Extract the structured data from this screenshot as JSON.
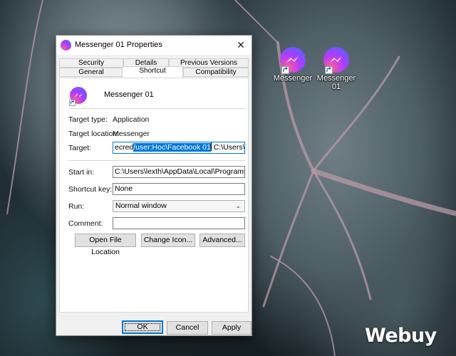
{
  "desktop": {
    "icons": [
      {
        "label": "Messenger",
        "icon": "messenger-icon"
      },
      {
        "label": "Messenger 01",
        "icon": "messenger-icon"
      }
    ],
    "watermark": "Webuy"
  },
  "dialog": {
    "title": "Messenger 01 Properties",
    "close_glyph": "✕",
    "tabs_row_back": [
      "Security",
      "Details",
      "Previous Versions"
    ],
    "tabs_row_front": [
      "General",
      "Shortcut",
      "Compatibility"
    ],
    "active_tab": "Shortcut",
    "shortcut_name": "Messenger 01",
    "target_type_label": "Target type:",
    "target_type_value": "Application",
    "target_location_label": "Target location:",
    "target_location_value": "Messenger",
    "target_label": "Target:",
    "target_value_before": "ecred",
    "target_value_selected": "/user:Hoc\\Facebook 01",
    "target_value_after": " C:\\Users\\lexth\\Ap",
    "start_in_label": "Start in:",
    "start_in_value": "C:\\Users\\lexth\\AppData\\Local\\Programs\\Messen",
    "shortcut_key_label": "Shortcut key:",
    "shortcut_key_value": "None",
    "run_label": "Run:",
    "run_value": "Normal window",
    "comment_label": "Comment:",
    "comment_value": "",
    "open_file_location_button": "Open File Location",
    "change_icon_button": "Change Icon...",
    "advanced_button": "Advanced...",
    "ok_button": "OK",
    "cancel_button": "Cancel",
    "apply_button": "Apply"
  },
  "colors": {
    "accent": "#0078d7",
    "messenger_gradient": [
      "#ff5f8f",
      "#b23bff",
      "#3d6bff"
    ]
  }
}
